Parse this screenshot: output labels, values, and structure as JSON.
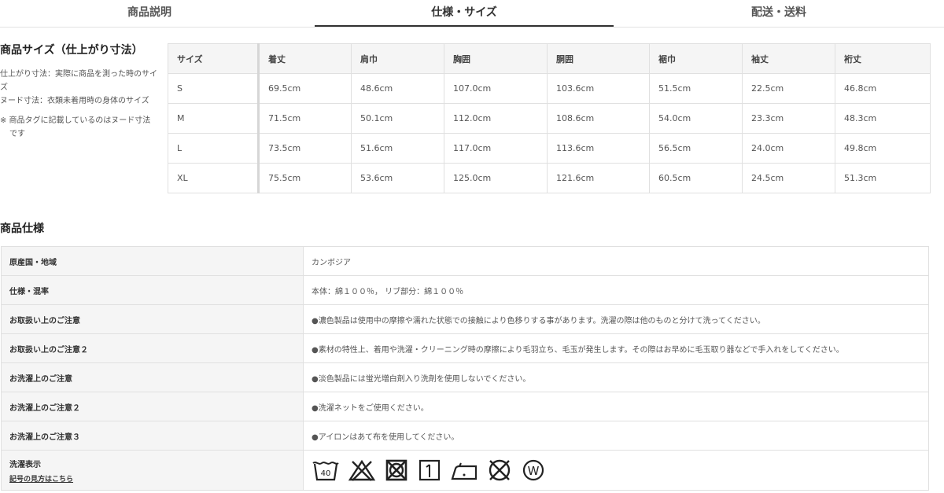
{
  "tabs": [
    {
      "label": "商品説明"
    },
    {
      "label": "仕様・サイズ"
    },
    {
      "label": "配送・送料"
    }
  ],
  "size_section": {
    "title": "商品サイズ（仕上がり寸法）",
    "note1": "仕上がり寸法：実際に商品を測った時のサイズ",
    "note2": "ヌード寸法：衣類未着用時の身体のサイズ",
    "note3": "※ 商品タグに記載しているのはヌード寸法です"
  },
  "size_table": {
    "headers": [
      "サイズ",
      "着丈",
      "肩巾",
      "胸囲",
      "胴囲",
      "裾巾",
      "袖丈",
      "裄丈"
    ],
    "rows": [
      [
        "S",
        "69.5cm",
        "48.6cm",
        "107.0cm",
        "103.6cm",
        "51.5cm",
        "22.5cm",
        "46.8cm"
      ],
      [
        "M",
        "71.5cm",
        "50.1cm",
        "112.0cm",
        "108.6cm",
        "54.0cm",
        "23.3cm",
        "48.3cm"
      ],
      [
        "L",
        "73.5cm",
        "51.6cm",
        "117.0cm",
        "113.6cm",
        "56.5cm",
        "24.0cm",
        "49.8cm"
      ],
      [
        "XL",
        "75.5cm",
        "53.6cm",
        "125.0cm",
        "121.6cm",
        "60.5cm",
        "24.5cm",
        "51.3cm"
      ]
    ]
  },
  "spec_section": {
    "title": "商品仕様",
    "rows": [
      {
        "key": "原産国・地域",
        "value": "カンボジア"
      },
      {
        "key": "仕様・混率",
        "value": "本体：綿１００％， リブ部分：綿１００％"
      },
      {
        "key": "お取扱い上のご注意",
        "value": "●濃色製品は使用中の摩擦や濡れた状態での接触により色移りする事があります。洗濯の際は他のものと分けて洗ってください。"
      },
      {
        "key": "お取扱い上のご注意２",
        "value": "●素材の特性上、着用や洗濯・クリーニング時の摩擦により毛羽立ち、毛玉が発生します。その際はお早めに毛玉取り器などで手入れをしてください。"
      },
      {
        "key": "お洗濯上のご注意",
        "value": "●淡色製品には蛍光増白剤入り洗剤を使用しないでください。"
      },
      {
        "key": "お洗濯上のご注意２",
        "value": "●洗濯ネットをご使用ください。"
      },
      {
        "key": "お洗濯上のご注意３",
        "value": "●アイロンはあて布を使用してください。"
      }
    ],
    "care": {
      "key": "洗濯表示",
      "link": "記号の見方はこちら",
      "wash_temp": "40",
      "dry_clean_letter": "W",
      "icons": [
        "wash-40-icon",
        "no-bleach-icon",
        "no-tumble-dry-icon",
        "hang-dry-icon",
        "iron-low-icon",
        "no-dry-clean-icon",
        "wet-clean-icon"
      ]
    }
  }
}
